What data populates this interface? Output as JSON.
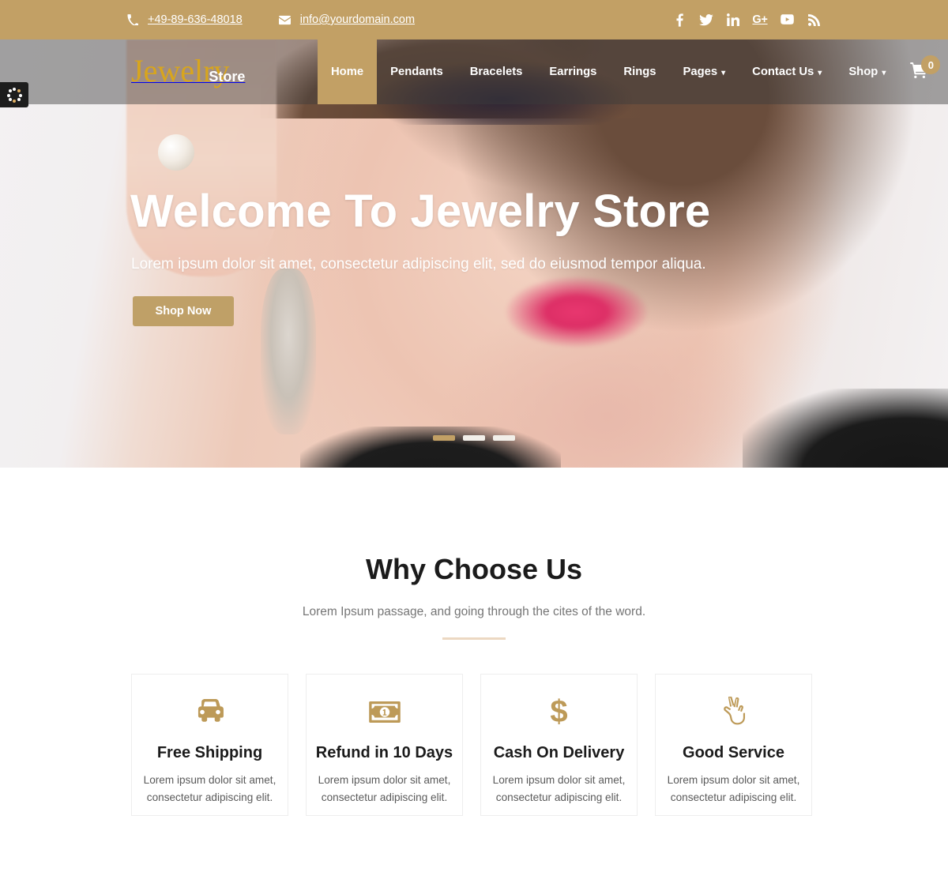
{
  "topbar": {
    "phone": "+49-89-636-48018",
    "email": "info@yourdomain.com",
    "phone_icon": "phone-icon",
    "email_icon": "envelope-icon",
    "socials": [
      {
        "name": "facebook",
        "glyph": "f"
      },
      {
        "name": "twitter",
        "glyph": "t"
      },
      {
        "name": "linkedin",
        "glyph": "in"
      },
      {
        "name": "google-plus",
        "glyph": "G+"
      },
      {
        "name": "youtube",
        "glyph": "yt"
      },
      {
        "name": "rss",
        "glyph": "rss"
      }
    ],
    "bg_color": "#c2a065"
  },
  "navbar": {
    "brand_primary": "Jewelry",
    "brand_secondary": "Store",
    "brand_color": "#d8a51d",
    "items": [
      {
        "label": "Home",
        "active": true,
        "has_caret": false
      },
      {
        "label": "Pendants",
        "active": false,
        "has_caret": false
      },
      {
        "label": "Bracelets",
        "active": false,
        "has_caret": false
      },
      {
        "label": "Earrings",
        "active": false,
        "has_caret": false
      },
      {
        "label": "Rings",
        "active": false,
        "has_caret": false
      },
      {
        "label": "Pages",
        "active": false,
        "has_caret": true
      },
      {
        "label": "Contact Us",
        "active": false,
        "has_caret": true
      },
      {
        "label": "Shop",
        "active": false,
        "has_caret": true
      }
    ],
    "cart_icon": "shopping-cart-icon",
    "cart_count": "0",
    "active_color": "#c2a065"
  },
  "loader": {
    "icon": "loading-spinner-icon"
  },
  "hero": {
    "title": "Welcome To Jewelry Store",
    "subtitle": "Lorem ipsum dolor sit amet, consectetur adipiscing elit, sed do eiusmod tempor aliqua.",
    "button_label": "Shop Now",
    "button_color": "#bfa067",
    "slides": [
      {
        "active": true
      },
      {
        "active": false
      },
      {
        "active": false
      }
    ]
  },
  "why_choose_us": {
    "title": "Why Choose Us",
    "subtitle": "Lorem Ipsum passage, and going through the cites of the word.",
    "divider_color": "#ecd8c2",
    "accent_color": "#bd9a58",
    "cards": [
      {
        "icon": "car-icon",
        "title": "Free Shipping",
        "text": "Lorem ipsum dolor sit amet, consectetur adipiscing elit."
      },
      {
        "icon": "banknote-icon",
        "title": "Refund in 10 Days",
        "text": "Lorem ipsum dolor sit amet, consectetur adipiscing elit."
      },
      {
        "icon": "dollar-sign-icon",
        "title": "Cash On Delivery",
        "text": "Lorem ipsum dolor sit amet, consectetur adipiscing elit."
      },
      {
        "icon": "hand-victory-icon",
        "title": "Good Service",
        "text": "Lorem ipsum dolor sit amet, consectetur adipiscing elit."
      }
    ]
  }
}
